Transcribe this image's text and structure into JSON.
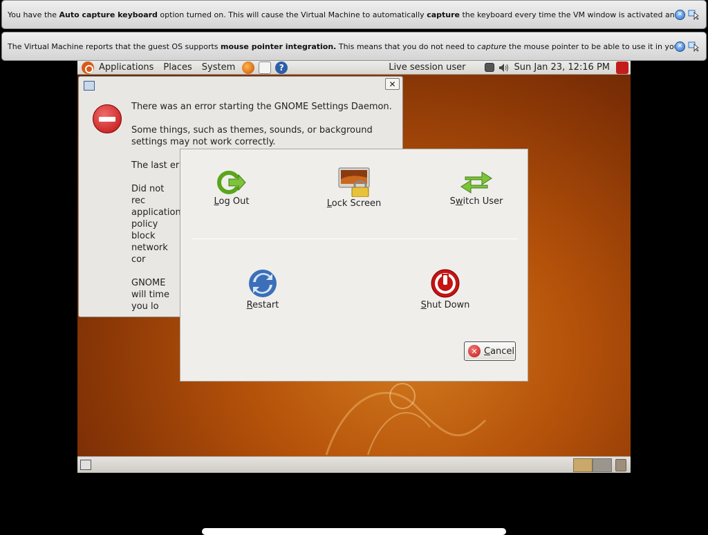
{
  "notices": [
    {
      "parts": [
        {
          "text": "You have the ",
          "bold": false
        },
        {
          "text": "Auto capture keyboard",
          "bold": true
        },
        {
          "text": " option turned on. This will cause the Virtual Machine to automatically ",
          "bold": false
        },
        {
          "text": "capture",
          "bold": true
        },
        {
          "text": " the keyboard every time the VM window is activated and make it unavailable to",
          "bold": false
        }
      ]
    },
    {
      "parts": [
        {
          "text": "The Virtual Machine reports that the guest OS supports ",
          "bold": false
        },
        {
          "text": "mouse pointer integration.",
          "bold": true
        },
        {
          "text": " This means that you do not need to ",
          "bold": false
        },
        {
          "text": "capture",
          "italic": true
        },
        {
          "text": " the mouse pointer to be able to use it in your guest OS -- all mouse",
          "bold": false
        }
      ]
    }
  ],
  "top_panel": {
    "menus": [
      "Applications",
      "Places",
      "System"
    ],
    "session_user": "Live session user",
    "clock": "Sun Jan 23, 12:16 PM"
  },
  "error_dialog": {
    "paragraphs": [
      "There was an error starting the GNOME Settings Daemon.",
      "Some things, such as themes, sounds, or background settings may not work correctly.",
      "The last err",
      "Did not rec application policy block network cor",
      "GNOME will time you lo"
    ]
  },
  "logout_dialog": {
    "options": {
      "log_out": {
        "pre": "",
        "key": "L",
        "post": "og Out"
      },
      "lock_screen": {
        "pre": "",
        "key": "L",
        "post": "ock Screen"
      },
      "switch_user": {
        "pre": "S",
        "key": "w",
        "post": "itch User"
      },
      "restart": {
        "pre": "",
        "key": "R",
        "post": "estart"
      },
      "shut_down": {
        "pre": "",
        "key": "S",
        "post": "hut Down"
      }
    },
    "cancel": {
      "key": "C",
      "post": "ancel"
    }
  }
}
